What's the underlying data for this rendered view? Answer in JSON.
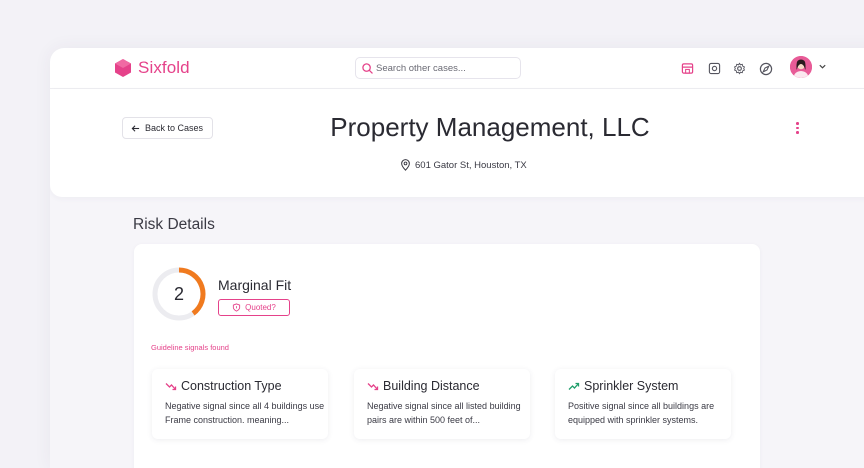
{
  "app": {
    "name": "Sixfold",
    "brand_color": "#e5428a"
  },
  "search": {
    "placeholder": "Search other cases..."
  },
  "toolbar_icons": [
    "store-icon",
    "box-icon",
    "gear-icon",
    "compass-icon"
  ],
  "header": {
    "back_label": "Back to Cases",
    "title": "Property Management, LLC",
    "address": "601 Gator St, Houston, TX"
  },
  "risk": {
    "section_title": "Risk Details",
    "score": "2",
    "score_fraction": 0.4,
    "fit_label": "Marginal Fit",
    "quoted_label": "Quoted?",
    "guideline_label": "Guideline signals found",
    "signals": [
      {
        "title": "Construction Type",
        "trend": "negative",
        "desc": "Negative signal since all 4 buildings use Frame construction. meaning..."
      },
      {
        "title": "Building Distance",
        "trend": "negative",
        "desc": "Negative signal since all listed building pairs are within 500 feet of..."
      },
      {
        "title": "Sprinkler System",
        "trend": "positive",
        "desc": "Positive signal since all buildings are equipped with sprinkler systems."
      }
    ]
  },
  "colors": {
    "negative": "#e5428a",
    "positive": "#1e9e6a",
    "ring": "#f07a1f"
  }
}
